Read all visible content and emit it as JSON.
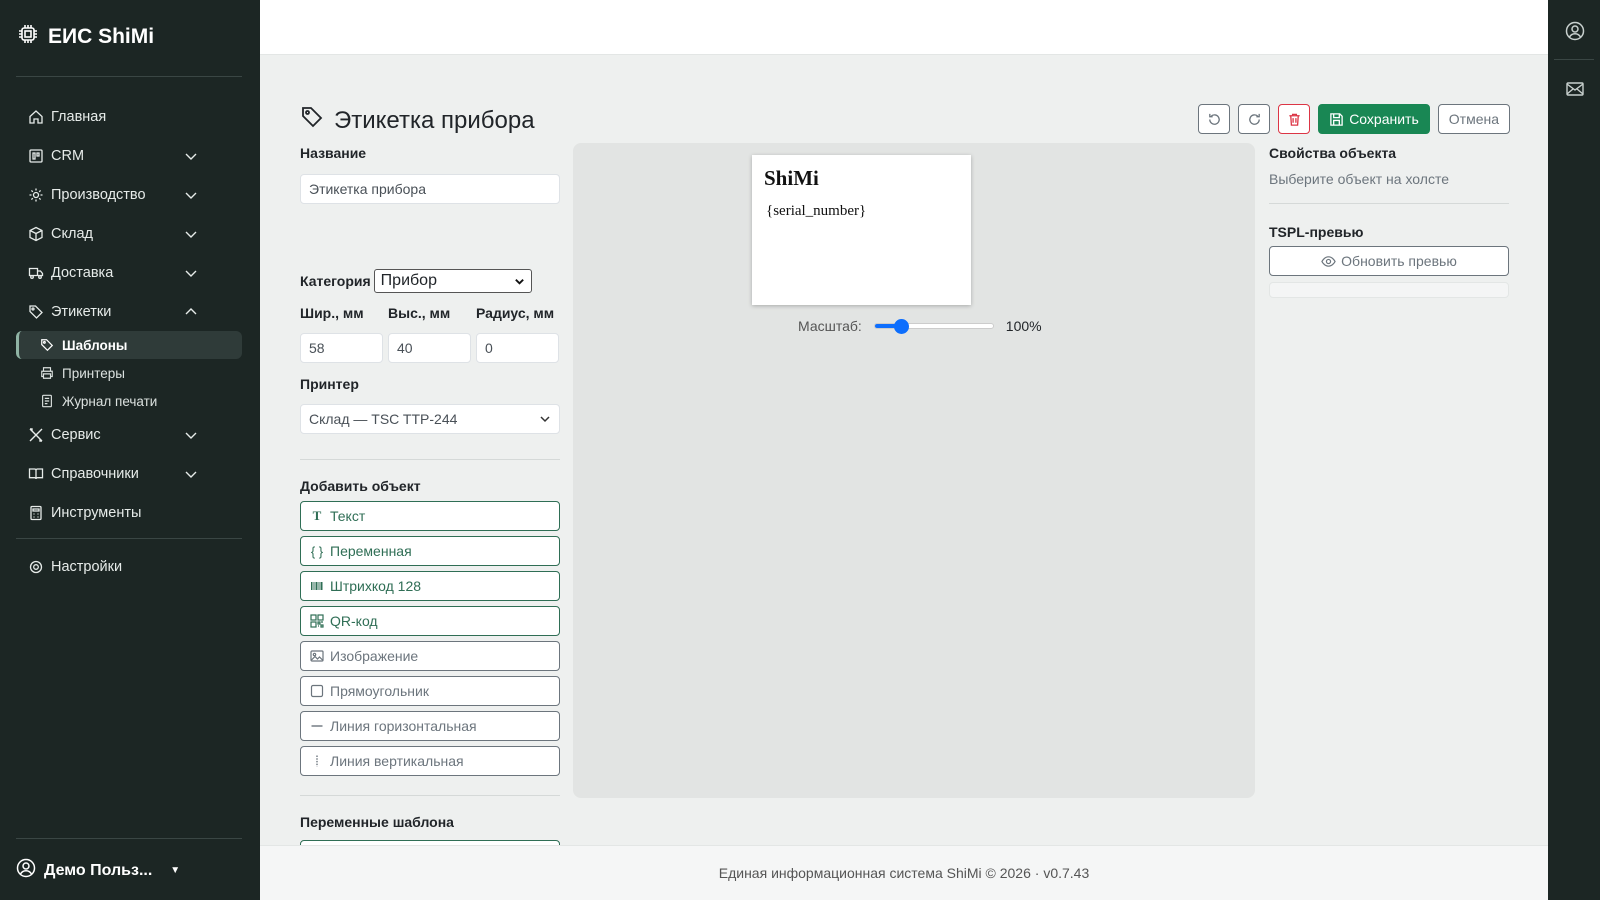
{
  "app": {
    "title": "ЕИС ShiMi"
  },
  "sidebar": {
    "items": [
      {
        "label": "Главная",
        "icon": "home-icon"
      },
      {
        "label": "CRM",
        "icon": "crm-icon",
        "expandable": true
      },
      {
        "label": "Производство",
        "icon": "gear-icon",
        "expandable": true
      },
      {
        "label": "Склад",
        "icon": "box-icon",
        "expandable": true
      },
      {
        "label": "Доставка",
        "icon": "truck-icon",
        "expandable": true
      },
      {
        "label": "Этикетки",
        "icon": "tags-icon",
        "expanded": true
      },
      {
        "label": "Сервис",
        "icon": "tools-icon",
        "expandable": true
      },
      {
        "label": "Справочники",
        "icon": "book-icon",
        "expandable": true
      },
      {
        "label": "Инструменты",
        "icon": "calculator-icon"
      },
      {
        "label": "Настройки",
        "icon": "settings-icon"
      }
    ],
    "subitems": [
      {
        "label": "Шаблоны",
        "icon": "tags-icon",
        "active": true
      },
      {
        "label": "Принтеры",
        "icon": "printer-icon"
      },
      {
        "label": "Журнал печати",
        "icon": "journal-icon"
      }
    ]
  },
  "user": {
    "name": "Демо Польз..."
  },
  "page": {
    "title": "Этикетка прибора"
  },
  "toolbar": {
    "save_label": "Сохранить",
    "cancel_label": "Отмена"
  },
  "form": {
    "name_label": "Название",
    "name_value": "Этикетка прибора",
    "category_label": "Категория",
    "category_value": "Прибор",
    "width_label": "Шир., мм",
    "width_value": "58",
    "height_label": "Выс., мм",
    "height_value": "40",
    "radius_label": "Радиус, мм",
    "radius_value": "0",
    "printer_label": "Принтер",
    "printer_value": "Склад — TSC TTP-244",
    "add_object_label": "Добавить объект",
    "objects": [
      {
        "label": "Текст",
        "icon": "text-icon"
      },
      {
        "label": "Переменная",
        "icon": "braces-icon"
      },
      {
        "label": "Штрихкод 128",
        "icon": "barcode-icon"
      },
      {
        "label": "QR-код",
        "icon": "qr-icon"
      },
      {
        "label": "Изображение",
        "icon": "image-icon"
      },
      {
        "label": "Прямоугольник",
        "icon": "square-icon"
      },
      {
        "label": "Линия горизонтальная",
        "icon": "hline-icon"
      },
      {
        "label": "Линия вертикальная",
        "icon": "vline-icon"
      }
    ],
    "template_vars_label": "Переменные шаблона"
  },
  "canvas": {
    "label_title": "ShiMi",
    "label_var": "{serial_number}",
    "zoom_label": "Масштаб:",
    "zoom_value": "100%",
    "zoom_fraction": 0.22
  },
  "props": {
    "title": "Свойства объекта",
    "hint": "Выберите объект на холсте",
    "tspl_title": "TSPL-превью",
    "refresh_label": "Обновить превью"
  },
  "footer": {
    "text": "Единая информационная система ShiMi © 2026 · v0.7.43"
  },
  "colors": {
    "sidebar_bg": "#1c2624",
    "save_green": "#198754",
    "outline_green": "#2f6e55",
    "delete_red": "#dc3545",
    "slider_blue": "#0d6efd"
  }
}
